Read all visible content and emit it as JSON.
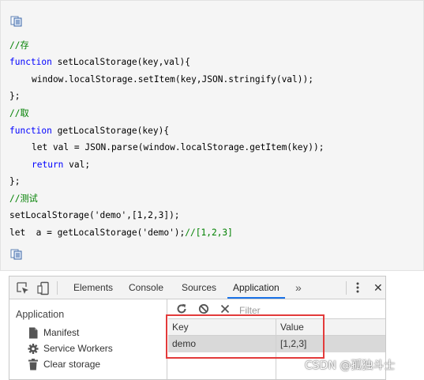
{
  "code": {
    "lines": [
      "//存",
      "setLocalStorage(key,val){",
      "window.localStorage.setItem(key,JSON.stringify(val));",
      "};",
      "//取",
      "getLocalStorage(key){",
      "let val = JSON.parse(window.localStorage.getItem(key));",
      "val;",
      "};",
      "//测试",
      "setLocalStorage('demo',[1,2,3]);",
      "let  a = getLocalStorage('demo');",
      "//[1,2,3]"
    ],
    "keyword_function": "function",
    "keyword_return": "return"
  },
  "devtools": {
    "tabs": [
      "Elements",
      "Console",
      "Sources",
      "Application"
    ],
    "active_tab": "Application",
    "more_tabs_label": "»",
    "close_label": "✕",
    "sidebar": {
      "heading": "Application",
      "items": [
        {
          "label": "Manifest",
          "icon": "file-icon"
        },
        {
          "label": "Service Workers",
          "icon": "gear-icon"
        },
        {
          "label": "Clear storage",
          "icon": "trash-icon"
        }
      ]
    },
    "storage": {
      "filter_placeholder": "Filter",
      "columns": [
        "Key",
        "Value"
      ],
      "rows": [
        {
          "key": "demo",
          "value": "[1,2,3]"
        }
      ]
    }
  },
  "watermark": "CSDN @孤独斗士",
  "colors": {
    "comment": "#008000",
    "keyword": "#0000ff",
    "highlight": "#e33b3b",
    "active_tab_underline": "#1a73e8"
  }
}
